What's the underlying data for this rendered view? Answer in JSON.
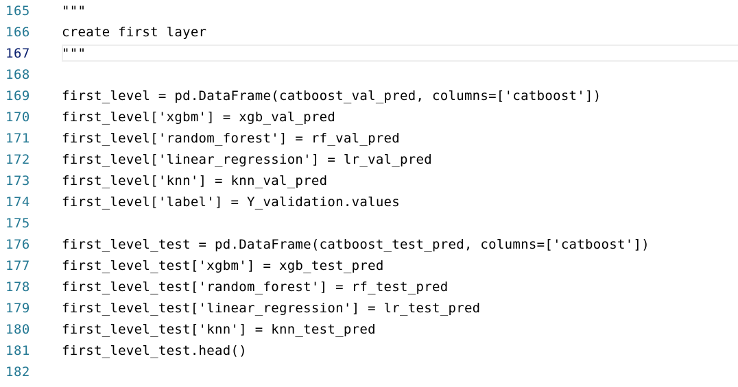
{
  "editor": {
    "lines": [
      {
        "number": "165",
        "code": "\"\"\""
      },
      {
        "number": "166",
        "code": "create first layer"
      },
      {
        "number": "167",
        "code": "\"\"\""
      },
      {
        "number": "168",
        "code": ""
      },
      {
        "number": "169",
        "code": "first_level = pd.DataFrame(catboost_val_pred, columns=['catboost'])"
      },
      {
        "number": "170",
        "code": "first_level['xgbm'] = xgb_val_pred"
      },
      {
        "number": "171",
        "code": "first_level['random_forest'] = rf_val_pred"
      },
      {
        "number": "172",
        "code": "first_level['linear_regression'] = lr_val_pred"
      },
      {
        "number": "173",
        "code": "first_level['knn'] = knn_val_pred"
      },
      {
        "number": "174",
        "code": "first_level['label'] = Y_validation.values"
      },
      {
        "number": "175",
        "code": ""
      },
      {
        "number": "176",
        "code": "first_level_test = pd.DataFrame(catboost_test_pred, columns=['catboost'])"
      },
      {
        "number": "177",
        "code": "first_level_test['xgbm'] = xgb_test_pred"
      },
      {
        "number": "178",
        "code": "first_level_test['random_forest'] = rf_test_pred"
      },
      {
        "number": "179",
        "code": "first_level_test['linear_regression'] = lr_test_pred"
      },
      {
        "number": "180",
        "code": "first_level_test['knn'] = knn_test_pred"
      },
      {
        "number": "181",
        "code": "first_level_test.head()"
      },
      {
        "number": "182",
        "code": ""
      }
    ],
    "colors": {
      "line_number": "#237893",
      "active_line_number": "#0b216f",
      "text": "#000000",
      "background": "#ffffff",
      "current_line_border": "#eeeeee"
    }
  }
}
